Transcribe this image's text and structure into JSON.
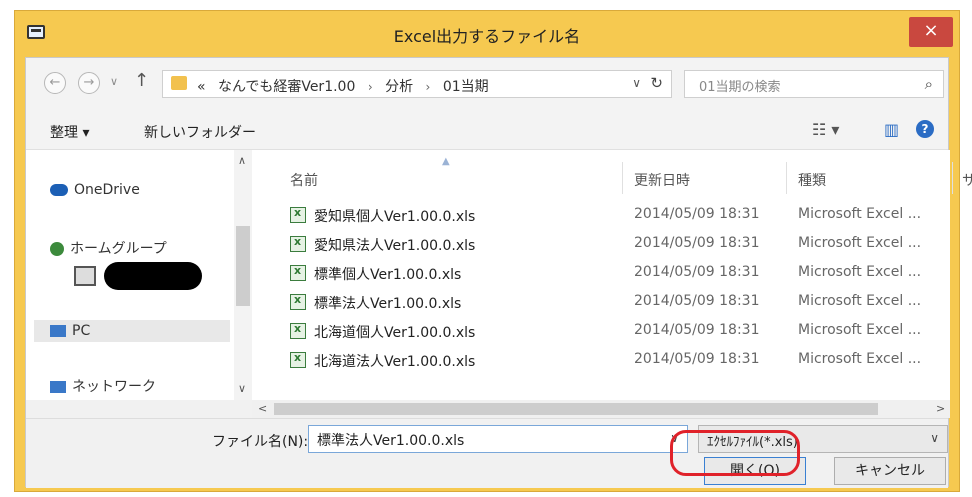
{
  "window": {
    "title": "Excel出力するファイル名",
    "close_glyph": "×"
  },
  "nav": {
    "back_glyph": "←",
    "forward_glyph": "→",
    "recent_glyph": "∨",
    "up_glyph": "↑",
    "breadcrumb_prefix": "«",
    "breadcrumb": [
      "なんでも経審Ver1.00",
      "分析",
      "01当期"
    ],
    "breadcrumb_sep": "›",
    "dropdown_glyph": "∨",
    "refresh_glyph": "↻",
    "search_placeholder": "01当期の検索",
    "search_glyph": "⌕"
  },
  "toolbar": {
    "organize": "整理 ▾",
    "new_folder": "新しいフォルダー",
    "view_glyph": "☷ ▾",
    "preview_glyph": "▥",
    "help_glyph": "?"
  },
  "sidebar": {
    "items": [
      "OneDrive",
      "ホームグループ",
      "PC",
      "ネットワーク"
    ],
    "selected_index": 2
  },
  "columns": [
    "名前",
    "更新日時",
    "種類",
    "サイ"
  ],
  "files": [
    {
      "name": "愛知県個人Ver1.00.0.xls",
      "date": "2014/05/09 18:31",
      "type": "Microsoft Excel ..."
    },
    {
      "name": "愛知県法人Ver1.00.0.xls",
      "date": "2014/05/09 18:31",
      "type": "Microsoft Excel ..."
    },
    {
      "name": "標準個人Ver1.00.0.xls",
      "date": "2014/05/09 18:31",
      "type": "Microsoft Excel ..."
    },
    {
      "name": "標準法人Ver1.00.0.xls",
      "date": "2014/05/09 18:31",
      "type": "Microsoft Excel ..."
    },
    {
      "name": "北海道個人Ver1.00.0.xls",
      "date": "2014/05/09 18:31",
      "type": "Microsoft Excel ..."
    },
    {
      "name": "北海道法人Ver1.00.0.xls",
      "date": "2014/05/09 18:31",
      "type": "Microsoft Excel ..."
    }
  ],
  "bottom": {
    "filename_label": "ファイル名(N):",
    "filename_value": "標準法人Ver1.00.0.xls",
    "filetype_value": "ｴｸｾﾙﾌｧｲﾙ(*.xls)",
    "dropdown_glyph": "∨",
    "open_label": "開く(O)",
    "cancel_label": "キャンセル"
  },
  "colors": {
    "title_bar": "#f6c950",
    "close_button": "#c9483f",
    "highlight": "#e0222a"
  }
}
